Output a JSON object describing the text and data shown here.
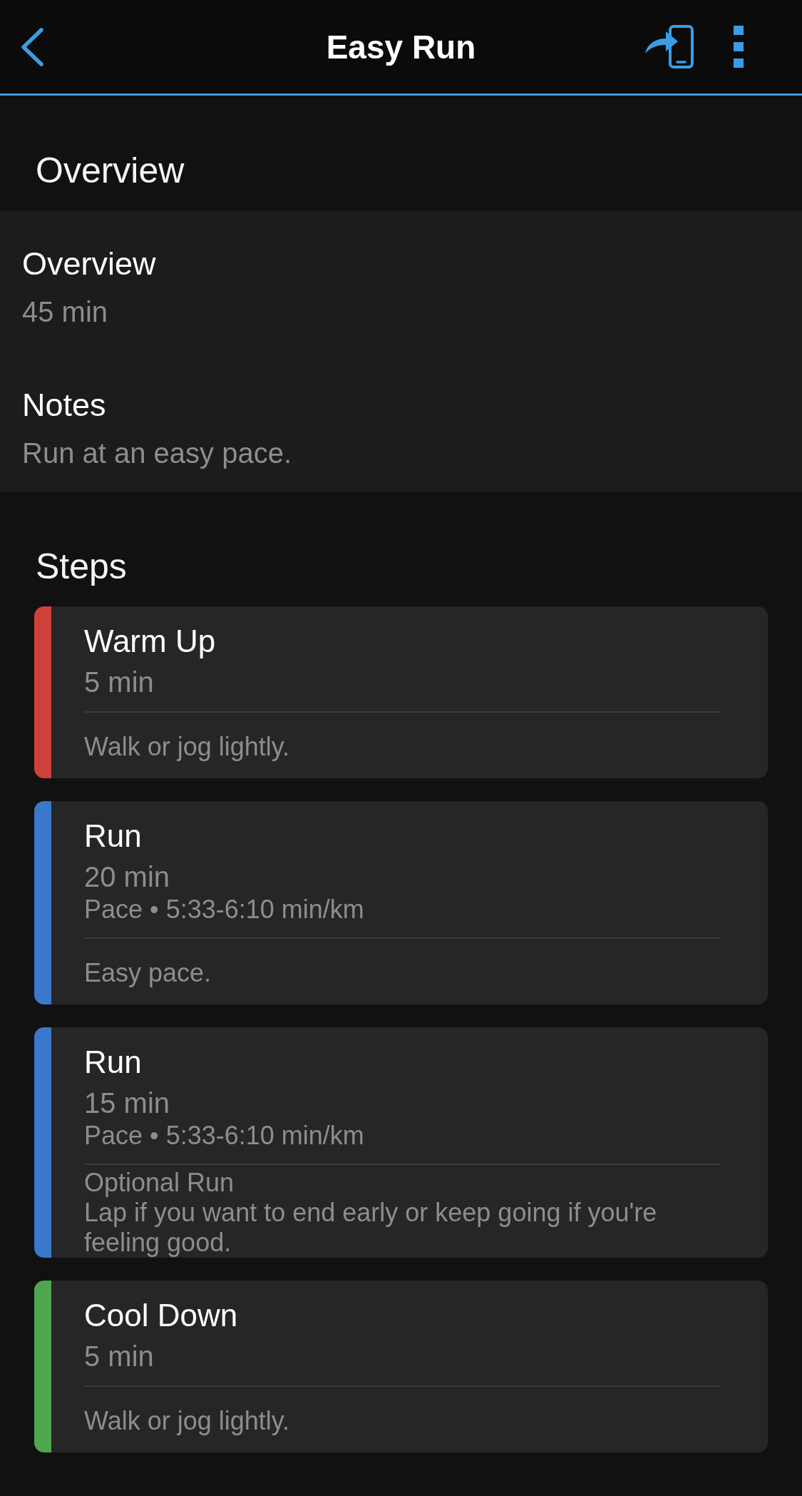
{
  "header": {
    "title": "Easy Run"
  },
  "overview_section": {
    "heading": "Overview",
    "items": [
      {
        "label": "Overview",
        "value": "45 min"
      },
      {
        "label": "Notes",
        "value": "Run at an easy pace."
      }
    ]
  },
  "steps_section": {
    "heading": "Steps",
    "steps": [
      {
        "title": "Warm Up",
        "duration": "5 min",
        "color": "#d0403a",
        "notes": [
          "Walk or jog lightly."
        ]
      },
      {
        "title": "Run",
        "duration": "20 min",
        "target": "Pace • 5:33-6:10 min/km",
        "color": "#3a78cc",
        "notes": [
          "Easy pace."
        ]
      },
      {
        "title": "Run",
        "duration": "15 min",
        "target": "Pace • 5:33-6:10 min/km",
        "color": "#3a78cc",
        "notes": [
          "Optional Run",
          "Lap if you want to end early or keep going if you're feeling good."
        ]
      },
      {
        "title": "Cool Down",
        "duration": "5 min",
        "color": "#4ea64f",
        "notes": [
          "Walk or jog lightly."
        ]
      }
    ]
  }
}
